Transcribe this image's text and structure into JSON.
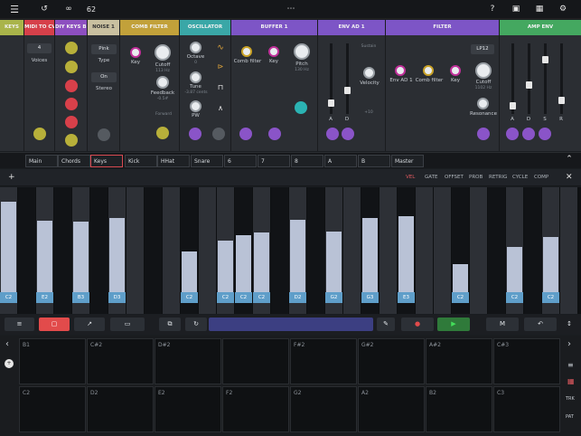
{
  "topbar": {
    "bpm": "62"
  },
  "modules": [
    {
      "title": "KEYS",
      "color": "#a9b44a"
    },
    {
      "title": "MIDI TO CV",
      "color": "#d6404a",
      "voices_value": "4",
      "voices_label": "Voices"
    },
    {
      "title": "DIY KEYS B 1",
      "color": "#8d4fc0"
    },
    {
      "title": "NOISE 1",
      "color": "#c9c0a0",
      "type_value": "Pink",
      "type_label": "Type",
      "stereo_value": "On",
      "stereo_label": "Stereo"
    },
    {
      "title": "COMB FILTER",
      "color": "#c2a13a",
      "key": "Key",
      "cutoff": "Cutoff",
      "cutoff_val": "113 Hz",
      "feedback": "Feedback",
      "feedback_val": "-0.5#",
      "forward": "Forward"
    },
    {
      "title": "OSCILLATOR",
      "color": "#3aa7a7",
      "octave": "Octave",
      "octave_val": "0",
      "tune": "Tune",
      "tune_val": "-3.87 cents",
      "pw": "PW"
    },
    {
      "title": "BUFFER 1",
      "color": "#7d55c6",
      "comb": "Comb filter",
      "key": "Key",
      "pitch": "Pitch",
      "pitch_val": "130 Hz"
    },
    {
      "title": "ENV AD 1",
      "color": "#7d55c6",
      "sustain": "Sustain",
      "velocity": "Velocity",
      "a": "A",
      "d": "D",
      "num": "+10"
    },
    {
      "title": "FILTER",
      "color": "#7d55c6",
      "mode": "LP12",
      "env": "Env AD 1",
      "comb": "Comb filter",
      "key": "Key",
      "cutoff": "Cutoff",
      "cutoff_val": "1102 Hz",
      "res": "Resonance"
    },
    {
      "title": "AMP ENV",
      "color": "#44a860",
      "a": "A",
      "d": "D",
      "s": "S",
      "r": "R"
    }
  ],
  "tabs": [
    "Main",
    "Chords",
    "Keys",
    "Kick",
    "HHat",
    "Snare",
    "6",
    "7",
    "8",
    "A",
    "B",
    "Master"
  ],
  "seq_header": [
    "VEL",
    "GATE",
    "OFFSET",
    "PROB",
    "RETRIG",
    "CYCLE",
    "COMP"
  ],
  "steps": [
    {
      "v": 0.86,
      "n": "C2"
    },
    {
      "v": 0,
      "n": ""
    },
    {
      "v": 0.68,
      "n": "E2"
    },
    {
      "v": 0,
      "n": ""
    },
    {
      "v": 0.67,
      "n": "B3"
    },
    {
      "v": 0,
      "n": ""
    },
    {
      "v": 0.71,
      "n": "D3"
    },
    {
      "v": 0,
      "n": ""
    },
    {
      "v": 0,
      "n": ""
    },
    {
      "v": 0,
      "n": ""
    },
    {
      "v": 0.39,
      "n": "C2"
    },
    {
      "v": 0,
      "n": ""
    },
    {
      "v": 0.49,
      "n": "C2"
    },
    {
      "v": 0.54,
      "n": "C2"
    },
    {
      "v": 0.57,
      "n": "C2"
    },
    {
      "v": 0,
      "n": ""
    },
    {
      "v": 0.69,
      "n": "D2"
    },
    {
      "v": 0,
      "n": ""
    },
    {
      "v": 0.58,
      "n": "G2"
    },
    {
      "v": 0,
      "n": ""
    },
    {
      "v": 0.71,
      "n": "G3"
    },
    {
      "v": 0,
      "n": ""
    },
    {
      "v": 0.72,
      "n": "E3"
    },
    {
      "v": 0,
      "n": ""
    },
    {
      "v": 0,
      "n": ""
    },
    {
      "v": 0.27,
      "n": "C2"
    },
    {
      "v": 0,
      "n": ""
    },
    {
      "v": 0,
      "n": ""
    },
    {
      "v": 0.43,
      "n": "C2"
    },
    {
      "v": 0,
      "n": ""
    },
    {
      "v": 0.53,
      "n": "C2"
    },
    {
      "v": 0,
      "n": ""
    }
  ],
  "pads_row1": [
    "B1",
    "C#2",
    "D#2",
    "",
    "F#2",
    "G#2",
    "A#2",
    "C#3"
  ],
  "pads_row2": [
    "C2",
    "D2",
    "E2",
    "F2",
    "G2",
    "A2",
    "B2",
    "C3"
  ],
  "side": {
    "trk": "TRK",
    "pat": "PAT"
  }
}
